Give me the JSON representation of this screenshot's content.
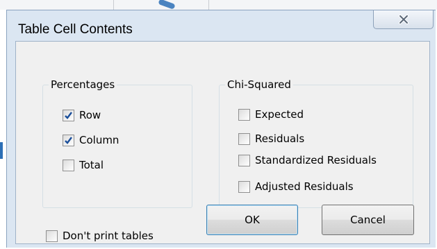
{
  "dialog": {
    "title": "Table Cell Contents",
    "close_icon": "close-x-icon"
  },
  "percentages": {
    "title": "Percentages",
    "items": [
      {
        "label": "Row",
        "checked": true
      },
      {
        "label": "Column",
        "checked": true
      },
      {
        "label": "Total",
        "checked": false
      }
    ]
  },
  "chi_squared": {
    "title": "Chi-Squared",
    "items": [
      {
        "label": "Expected",
        "checked": false
      },
      {
        "label": "Residuals",
        "checked": false
      },
      {
        "label": "Standardized Residuals",
        "checked": false
      },
      {
        "label": "Adjusted Residuals",
        "checked": false
      }
    ]
  },
  "options": {
    "dont_print": {
      "label": "Don't print tables",
      "checked": false
    }
  },
  "buttons": {
    "ok": "OK",
    "cancel": "Cancel"
  },
  "colors": {
    "check_blue": "#1a4e9a",
    "frame": "#dbe6f2",
    "client": "#f0f0f0"
  }
}
